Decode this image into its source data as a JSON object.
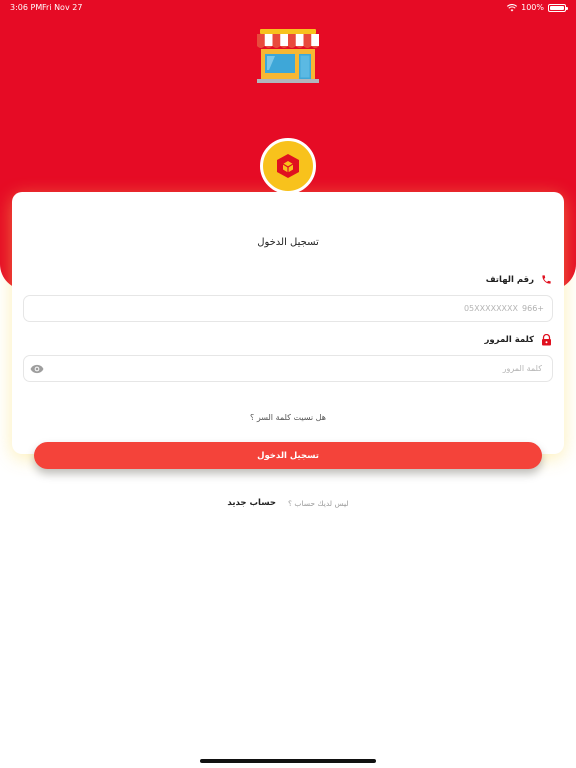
{
  "status_bar": {
    "time": "3:06 PM",
    "date": "Fri Nov 27",
    "battery": "100%"
  },
  "icons": {
    "wifi": "wifi-icon",
    "battery": "battery-icon",
    "shop": "storefront-icon",
    "logo": "cube-logo-icon",
    "phone": "phone-icon",
    "lock": "lock-icon",
    "eye": "eye-icon"
  },
  "login": {
    "title": "تسجيل الدخول",
    "phone_label": "رقم الهاتف",
    "phone_placeholder": "05XXXXXXXX",
    "country_code": "966+",
    "password_label": "كلمة المرور",
    "password_placeholder": "كلمة المرور",
    "forgot_password": "هل نسيت كلمة السر ؟",
    "submit_label": "تسجيل الدخول"
  },
  "signup": {
    "question": "ليس لديك حساب ؟",
    "link": "حساب جديد"
  },
  "colors": {
    "primary_red": "#e60b25",
    "button_red": "#f4433a",
    "logo_yellow": "#f8c21c",
    "icon_red": "#e0101f"
  }
}
